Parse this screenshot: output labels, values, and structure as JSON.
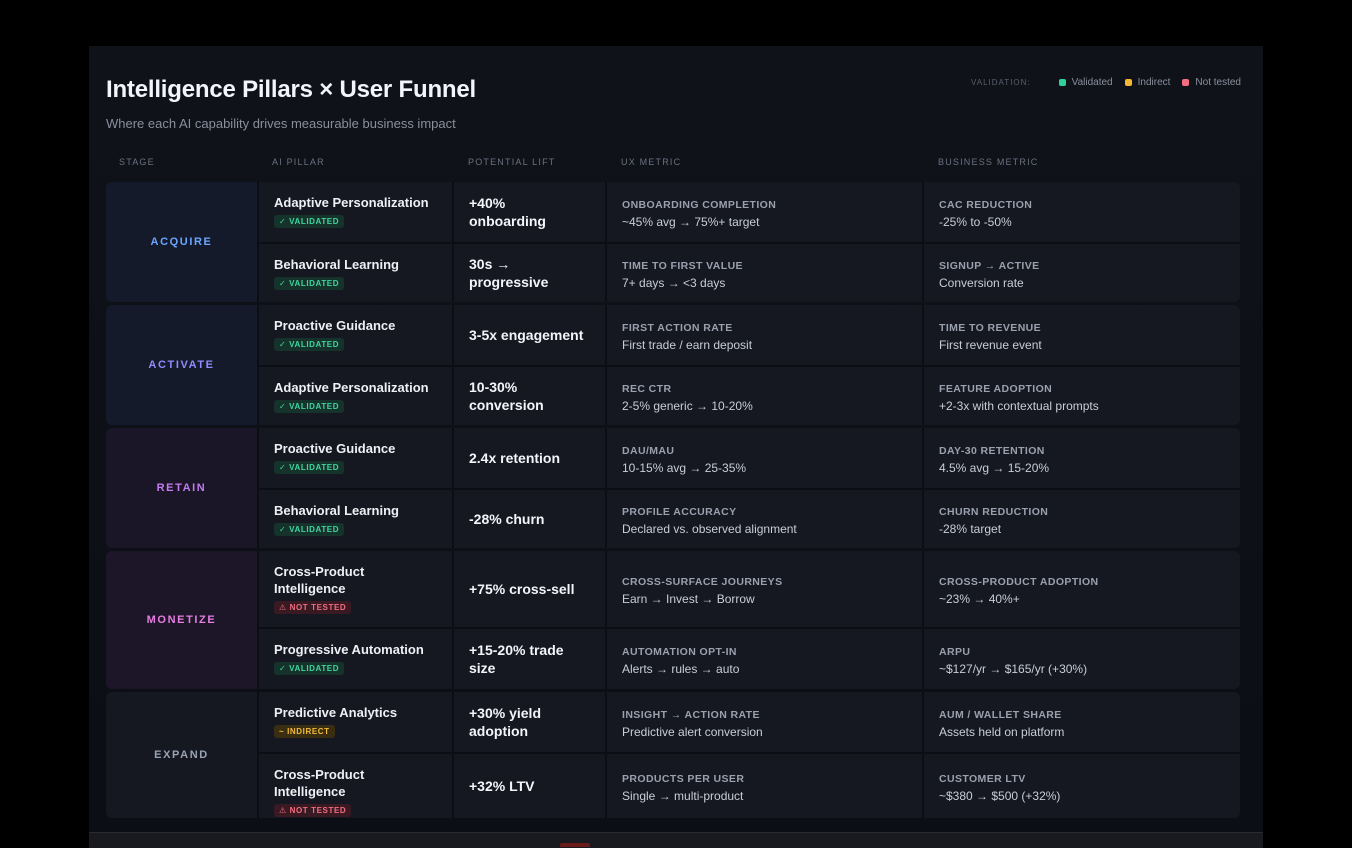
{
  "header": {
    "title": "Intelligence Pillars × User Funnel",
    "subtitle": "Where each AI capability drives measurable business impact"
  },
  "legend": {
    "label": "VALIDATION:",
    "items": [
      {
        "label": "Validated",
        "color": "#2fd39a"
      },
      {
        "label": "Indirect",
        "color": "#f5b731"
      },
      {
        "label": "Not tested",
        "color": "#f26d80"
      }
    ]
  },
  "columns": {
    "stage": "STAGE",
    "pillar": "AI PILLAR",
    "lift": "POTENTIAL LIFT",
    "ux": "UX METRIC",
    "business": "BUSINESS METRIC"
  },
  "colors": {
    "acquire": "#6aa6ff",
    "activate": "#8f8cff",
    "retain": "#c27cf0",
    "monetize": "#e77de0",
    "expand": "#9aa3b5"
  },
  "groups": [
    {
      "stage": "ACQUIRE",
      "rows": [
        {
          "pillar": "Adaptive Personalization",
          "badge": "✓ VALIDATED",
          "lift": "+40% onboarding",
          "ux_label": "ONBOARDING COMPLETION",
          "ux_value": "~45% avg → 75%+ target",
          "biz_label": "CAC REDUCTION",
          "biz_value": "-25% to -50%"
        },
        {
          "pillar": "Behavioral Learning",
          "badge": "✓ VALIDATED",
          "lift": "30s → progressive",
          "ux_label": "TIME TO FIRST VALUE",
          "ux_value": "7+ days → <3 days",
          "biz_label": "SIGNUP → ACTIVE",
          "biz_value": "Conversion rate"
        }
      ]
    },
    {
      "stage": "ACTIVATE",
      "rows": [
        {
          "pillar": "Proactive Guidance",
          "badge": "✓ VALIDATED",
          "lift": "3-5x engagement",
          "ux_label": "FIRST ACTION RATE",
          "ux_value": "First trade / earn deposit",
          "biz_label": "TIME TO REVENUE",
          "biz_value": "First revenue event"
        },
        {
          "pillar": "Adaptive Personalization",
          "badge": "✓ VALIDATED",
          "lift": "10-30% conversion",
          "ux_label": "REC CTR",
          "ux_value": "2-5% generic → 10-20%",
          "biz_label": "FEATURE ADOPTION",
          "biz_value": "+2-3x with contextual prompts"
        }
      ]
    },
    {
      "stage": "RETAIN",
      "rows": [
        {
          "pillar": "Proactive Guidance",
          "badge": "✓ VALIDATED",
          "lift": "2.4x retention",
          "ux_label": "DAU/MAU",
          "ux_value": "10-15% avg → 25-35%",
          "biz_label": "DAY-30 RETENTION",
          "biz_value": "4.5% avg → 15-20%"
        },
        {
          "pillar": "Behavioral Learning",
          "badge": "✓ VALIDATED",
          "lift": "-28% churn",
          "ux_label": "PROFILE ACCURACY",
          "ux_value": "Declared vs. observed alignment",
          "biz_label": "CHURN REDUCTION",
          "biz_value": "-28% target"
        }
      ]
    },
    {
      "stage": "MONETIZE",
      "rows": [
        {
          "pillar": "Cross-Product Intelligence",
          "badge": "⚠ NOT TESTED",
          "lift": "+75% cross-sell",
          "ux_label": "CROSS-SURFACE JOURNEYS",
          "ux_value": "Earn → Invest → Borrow",
          "biz_label": "CROSS-PRODUCT ADOPTION",
          "biz_value": "~23% → 40%+"
        },
        {
          "pillar": "Progressive Automation",
          "badge": "✓ VALIDATED",
          "lift": "+15-20% trade size",
          "ux_label": "AUTOMATION OPT-IN",
          "ux_value": "Alerts → rules → auto",
          "biz_label": "ARPU",
          "biz_value": "~$127/yr → $165/yr (+30%)"
        }
      ]
    },
    {
      "stage": "EXPAND",
      "rows": [
        {
          "pillar": "Predictive Analytics",
          "badge": "~ INDIRECT",
          "lift": "+30% yield adoption",
          "ux_label": "INSIGHT → ACTION RATE",
          "ux_value": "Predictive alert conversion",
          "biz_label": "AUM / WALLET SHARE",
          "biz_value": "Assets held on platform"
        },
        {
          "pillar": "Cross-Product Intelligence",
          "badge": "⚠ NOT TESTED",
          "lift": "+32% LTV",
          "ux_label": "PRODUCTS PER USER",
          "ux_value": "Single → multi-product",
          "biz_label": "CUSTOMER LTV",
          "biz_value": "~$380 → $500 (+32%)"
        }
      ]
    }
  ]
}
